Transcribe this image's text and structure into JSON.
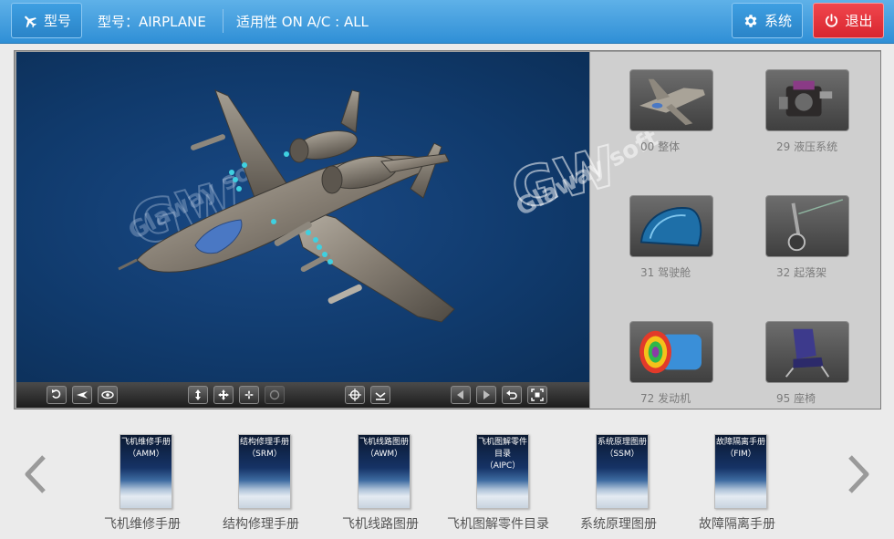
{
  "header": {
    "model_button_label": "型号",
    "model_text": "型号：AIRPLANE",
    "applicability_text": "适用性 ON A/C : ALL",
    "system_button_label": "系统",
    "exit_button_label": "退出"
  },
  "viewer": {
    "watermark_text": "Glaway soft",
    "toolbar_icons": [
      "rotate-icon",
      "airplane-view-icon",
      "eye-icon",
      "move-vertical-icon",
      "move-icon",
      "fan-icon",
      "reset-icon",
      "target-icon",
      "bottom-view-icon",
      "prev-icon",
      "next-icon",
      "undo-icon",
      "fit-view-icon"
    ]
  },
  "systems": [
    {
      "label": "00 整体",
      "icon": "airplane-thumb-icon"
    },
    {
      "label": "29 液压系统",
      "icon": "hydraulic-thumb-icon"
    },
    {
      "label": "31 驾驶舱",
      "icon": "cockpit-thumb-icon"
    },
    {
      "label": "32 起落架",
      "icon": "landing-gear-thumb-icon"
    },
    {
      "label": "72 发动机",
      "icon": "engine-thumb-icon"
    },
    {
      "label": "95 座椅",
      "icon": "seat-thumb-icon"
    }
  ],
  "manuals": [
    {
      "cover": "飞机维修手册\n（AMM）",
      "label": "飞机维修手册"
    },
    {
      "cover": "结构修理手册\n（SRM）",
      "label": "结构修理手册"
    },
    {
      "cover": "飞机线路图册\n（AWM）",
      "label": "飞机线路图册"
    },
    {
      "cover": "飞机图解零件\n目录\n（AIPC）",
      "label": "飞机图解零件目录"
    },
    {
      "cover": "系统原理图册\n（SSM）",
      "label": "系统原理图册"
    },
    {
      "cover": "故障隔离手册\n（FIM）",
      "label": "故障隔离手册"
    }
  ],
  "colors": {
    "header_blue": "#2f8fd6",
    "exit_red": "#d9262f",
    "viewer_bg": "#103a6c"
  }
}
